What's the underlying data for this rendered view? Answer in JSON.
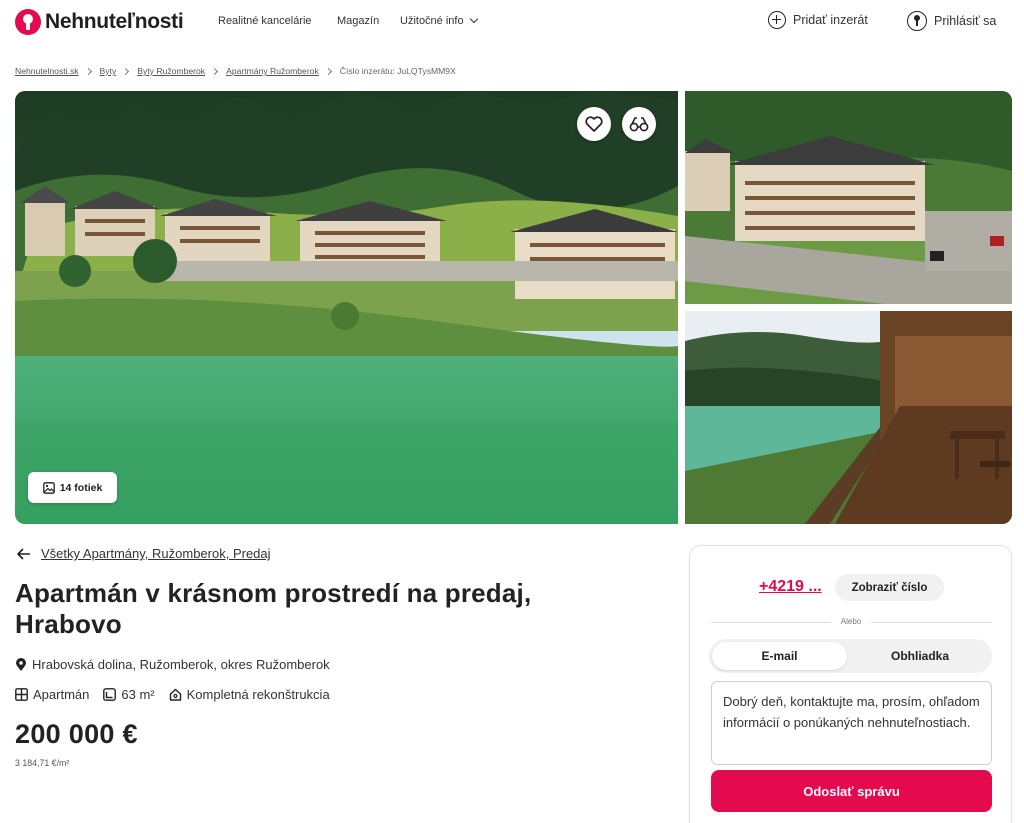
{
  "header": {
    "logo_text": "Nehnuteľnosti",
    "nav": [
      "Realitné kancelárie",
      "Magazín",
      "Užitočné info"
    ],
    "add_listing": "Pridať inzerát",
    "login": "Prihlásiť sa"
  },
  "breadcrumb": {
    "items": [
      "Nehnutelnosti.sk",
      "Byty",
      "Byty Ružomberok",
      "Apartmány Ružomberok"
    ],
    "listing_id": "Číslo inzerátu: JuLQTysMM9X"
  },
  "gallery": {
    "photos_label": "14 fotiek"
  },
  "listing": {
    "back_link": "Všetky Apartmány, Ružomberok, Predaj",
    "title": "Apartmán v krásnom prostredí na predaj, Hrabovo",
    "location": "Hrabovská dolina, Ružomberok, okres Ružomberok",
    "type": "Apartmán",
    "area": "63 m²",
    "condition": "Kompletná rekonštrukcia",
    "price": "200 000 €",
    "price_per_m2": "3 184,71 €/m²"
  },
  "contact": {
    "phone": "+4219 ...",
    "show_number": "Zobraziť číslo",
    "or_label": "Alebo",
    "tabs": [
      "E-mail",
      "Obhliadka"
    ],
    "active_tab": "E-mail",
    "message": "Dobrý deň, kontaktujte ma, prosím, ohľadom informácií o ponúkaných nehnuteľnostiach.",
    "send_button": "Odoslať správu"
  },
  "colors": {
    "accent": "#e5094f",
    "text": "#1f1f1f"
  },
  "icons": [
    "logo-icon",
    "chevron-down-icon",
    "plus-circle-icon",
    "user-lock-icon",
    "heart-icon",
    "compare-icon",
    "image-icon",
    "arrow-left-icon",
    "location-pin-icon",
    "grid-icon",
    "area-icon",
    "home-icon"
  ]
}
